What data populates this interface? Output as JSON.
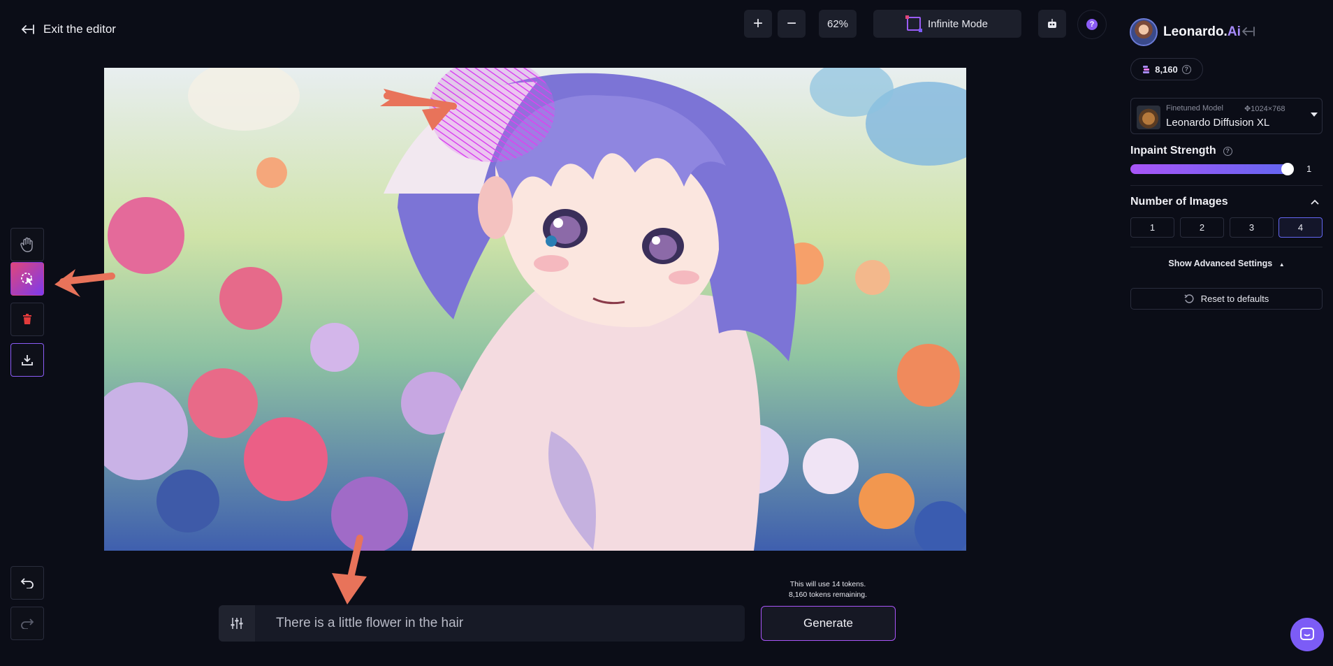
{
  "header": {
    "exit_label": "Exit the editor",
    "zoom_in": "+",
    "zoom_out": "−",
    "zoom_level": "62%",
    "infinite_mode": "Infinite Mode",
    "help": "?"
  },
  "canvas": {
    "image": "anime-girl-in-flower-field"
  },
  "tools": [
    "pan",
    "mask-brush",
    "erase",
    "download",
    "undo",
    "redo"
  ],
  "prompt": {
    "value": "There is a little flower in the hair",
    "token_note_line1": "This will use 14 tokens.",
    "token_note_line2": "8,160 tokens remaining.",
    "generate_label": "Generate"
  },
  "sidebar": {
    "brand_name": "Leonardo.",
    "brand_suffix": "Ai",
    "tokens": "8,160",
    "model": {
      "kind": "Finetuned Model",
      "size": "1024×768",
      "name": "Leonardo Diffusion XL"
    },
    "inpaint": {
      "label": "Inpaint Strength",
      "value": "1",
      "level": 1.0
    },
    "num_images": {
      "label": "Number of Images",
      "options": [
        "1",
        "2",
        "3",
        "4"
      ],
      "selected": "4"
    },
    "advanced_label": "Show Advanced Settings",
    "reset_label": "Reset to defaults"
  },
  "colors": {
    "background": "#0b0d17",
    "accent_purple": "#8b5cf6",
    "accent_pink": "#e0467a",
    "annotation_arrow": "#e8735a"
  }
}
